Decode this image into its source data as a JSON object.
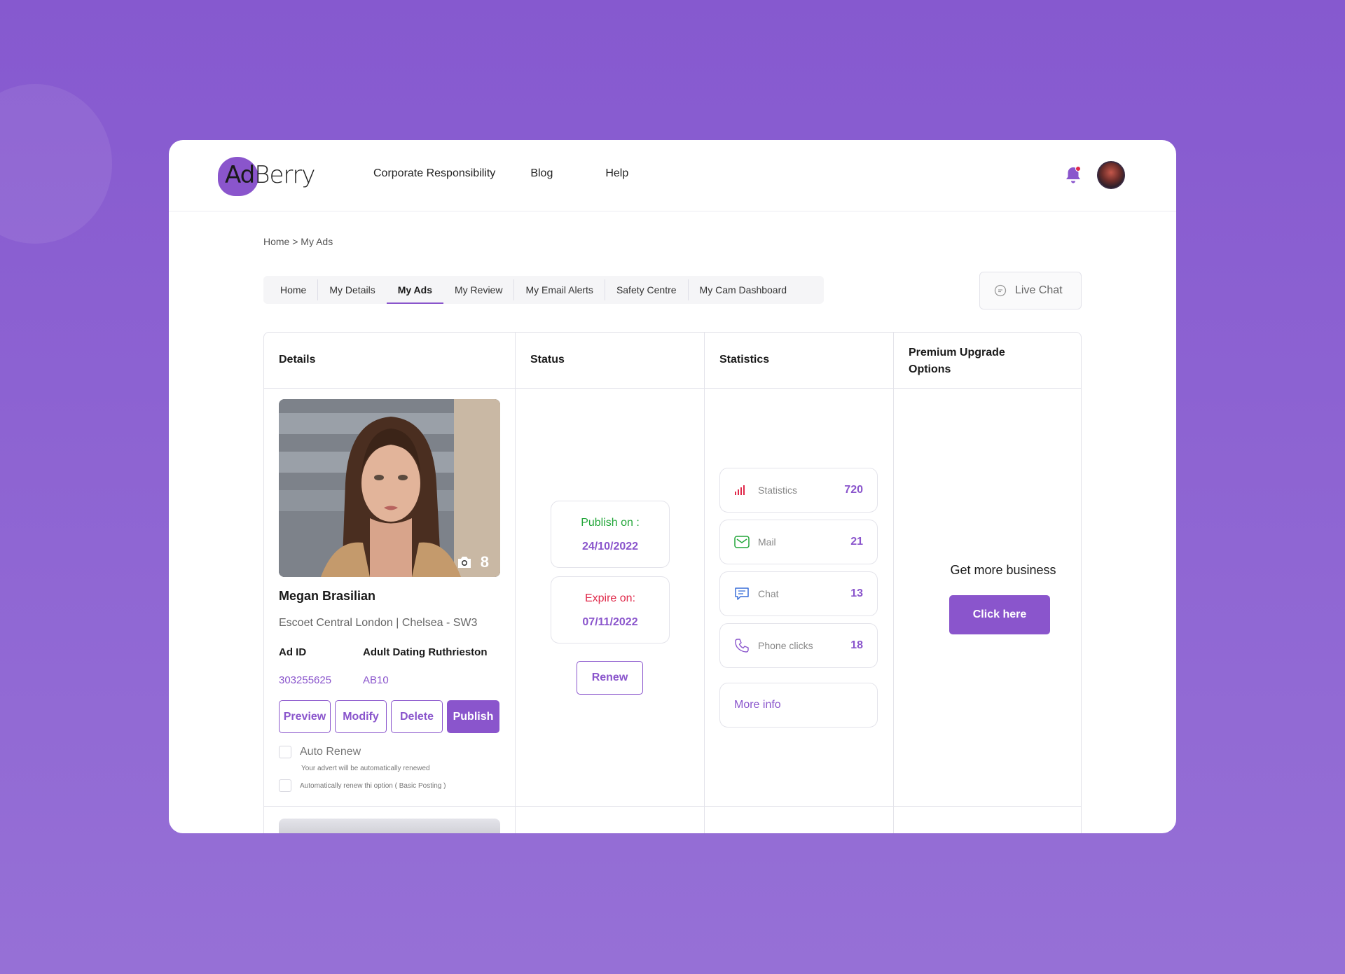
{
  "brand": {
    "logo_ad": "Ad",
    "logo_berry": "Berry"
  },
  "nav": {
    "items": [
      "Corporate Responsibility",
      "Blog",
      "Help"
    ]
  },
  "breadcrumb": "Home > My Ads",
  "tabs": [
    "Home",
    "My Details",
    "My Ads",
    "My Review",
    "My Email Alerts",
    "Safety Centre",
    "My Cam Dashboard"
  ],
  "active_tab": "My Ads",
  "live_chat": "Live Chat",
  "table": {
    "headers": [
      "Details",
      "Status",
      "Statistics",
      "Premium Upgrade Options"
    ]
  },
  "ad": {
    "photo_count": "8",
    "name": "Megan Brasilian",
    "location": "Escoet Central London | Chelsea - SW3",
    "ad_id_label": "Ad ID",
    "category_label": "Adult Dating Ruthrieston",
    "ad_id": "303255625",
    "category_code": "AB10",
    "buttons": {
      "preview": "Preview",
      "modify": "Modify",
      "delete": "Delete",
      "publish": "Publish"
    },
    "auto_renew_label": "Auto Renew",
    "auto_renew_hint": "Your advert will be automatically renewed",
    "auto_renew_option": "Automatically renew thi option ( Basic Posting )"
  },
  "status": {
    "publish_label": "Publish on :",
    "publish_date": "24/10/2022",
    "expire_label": "Expire on:",
    "expire_date": "07/11/2022",
    "renew": "Renew"
  },
  "statistics": {
    "items": [
      {
        "label": "Statistics",
        "value": "720",
        "icon": "bar-chart-icon"
      },
      {
        "label": "Mail",
        "value": "21",
        "icon": "mail-icon"
      },
      {
        "label": "Chat",
        "value": "13",
        "icon": "chat-icon"
      },
      {
        "label": "Phone clicks",
        "value": "18",
        "icon": "phone-icon"
      }
    ],
    "more_info": "More info"
  },
  "premium": {
    "text": "Get more business",
    "button": "Click here"
  },
  "colors": {
    "accent": "#8a55cc",
    "publish_green": "#23a63a",
    "expire_red": "#e0294a",
    "background": "#8659cf"
  }
}
